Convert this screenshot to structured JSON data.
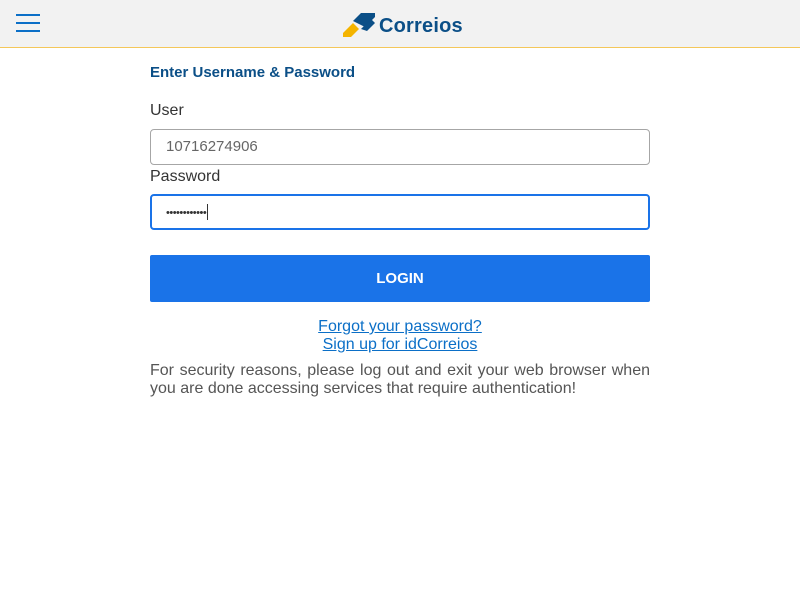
{
  "header": {
    "logo_text": "Correios",
    "menu_icon": "hamburger-icon",
    "colors": {
      "brand_blue": "#0b4f87",
      "brand_yellow": "#f4b400",
      "accent": "#1a73e8"
    }
  },
  "form": {
    "heading": "Enter Username & Password",
    "user_label": "User",
    "user_value": "10716274906",
    "password_label": "Password",
    "password_value": "••••••••••••",
    "login_label": "LOGIN"
  },
  "links": {
    "forgot_password": "Forgot your password?",
    "sign_up": "Sign up for idCorreios"
  },
  "notice": "For security reasons, please log out and exit your web browser when you are done accessing services that require authentication!"
}
